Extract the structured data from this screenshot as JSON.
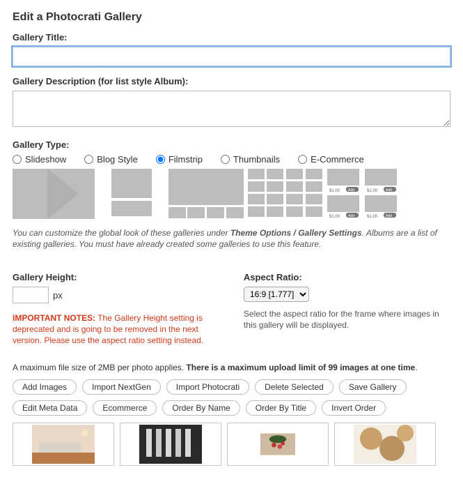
{
  "page_title": "Edit a Photocrati Gallery",
  "labels": {
    "gallery_title": "Gallery Title:",
    "gallery_description": "Gallery Description (for list style Album):",
    "gallery_type": "Gallery Type:",
    "gallery_height": "Gallery Height:",
    "aspect_ratio": "Aspect Ratio:"
  },
  "fields": {
    "title_value": "",
    "description_value": "",
    "height_value": "",
    "height_suffix": "px"
  },
  "gallery_types": {
    "options": [
      {
        "key": "slideshow",
        "label": "Slideshow",
        "checked": false
      },
      {
        "key": "blogstyle",
        "label": "Blog Style",
        "checked": false
      },
      {
        "key": "filmstrip",
        "label": "Filmstrip",
        "checked": true
      },
      {
        "key": "thumbnails",
        "label": "Thumbnails",
        "checked": false
      },
      {
        "key": "ecommerce",
        "label": "E-Commerce",
        "checked": false
      }
    ]
  },
  "customize_note_prefix": "You can customize the global look of these galleries under ",
  "customize_note_bold": "Theme Options / Gallery Settings",
  "customize_note_suffix": ". Albums are a list of existing galleries. You must have already created some galleries to use this feature.",
  "height_warning_bold": "IMPORTANT NOTES:",
  "height_warning_text": " The Gallery Height setting is deprecated and is going to be removed in the next version. Please use the aspect ratio setting instead.",
  "aspect_select": {
    "selected": "16:9 [1.777]"
  },
  "aspect_helper": "Select the aspect ratio for the frame where images in this gallery will be displayed.",
  "upload_note_prefix": "A maximum file size of 2MB per photo applies. ",
  "upload_note_bold": "There is a maximum upload limit of 99 images at one time",
  "upload_note_suffix": ".",
  "buttons_row1": [
    "Add Images",
    "Import NextGen",
    "Import Photocrati",
    "Delete Selected",
    "Save Gallery"
  ],
  "buttons_row2": [
    "Edit Meta Data",
    "Ecommerce",
    "Order By Name",
    "Order By Title",
    "Invert Order"
  ],
  "ecommerce_preview": {
    "price": "$1.00",
    "button": "Add"
  }
}
